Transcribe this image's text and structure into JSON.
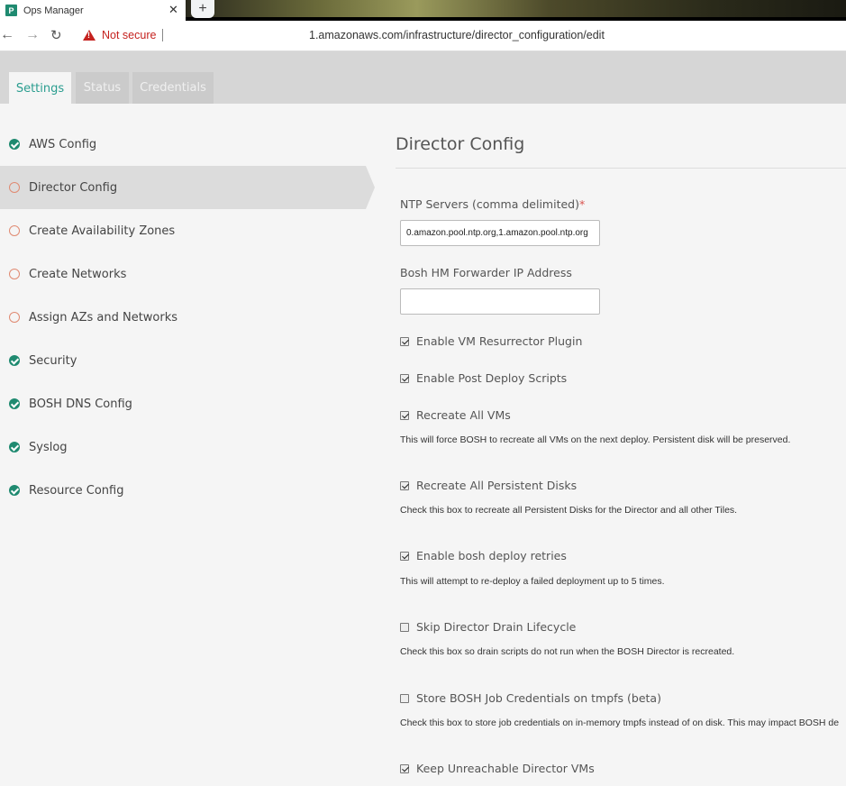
{
  "browser": {
    "tab_title": "Ops Manager",
    "favicon_letter": "P",
    "security_label": "Not secure",
    "url": "1.amazonaws.com/infrastructure/director_configuration/edit"
  },
  "app_tabs": [
    {
      "label": "Settings",
      "active": true
    },
    {
      "label": "Status",
      "active": false
    },
    {
      "label": "Credentials",
      "active": false
    }
  ],
  "sidebar": {
    "items": [
      {
        "label": "AWS Config",
        "status": "complete"
      },
      {
        "label": "Director Config",
        "status": "incomplete",
        "active": true
      },
      {
        "label": "Create Availability Zones",
        "status": "incomplete"
      },
      {
        "label": "Create Networks",
        "status": "incomplete"
      },
      {
        "label": "Assign AZs and Networks",
        "status": "incomplete"
      },
      {
        "label": "Security",
        "status": "complete"
      },
      {
        "label": "BOSH DNS Config",
        "status": "complete"
      },
      {
        "label": "Syslog",
        "status": "complete"
      },
      {
        "label": "Resource Config",
        "status": "complete"
      }
    ]
  },
  "main": {
    "title": "Director Config",
    "ntp": {
      "label": "NTP Servers (comma delimited)",
      "required_mark": "*",
      "value": "0.amazon.pool.ntp.org,1.amazon.pool.ntp.org"
    },
    "bosh_hm": {
      "label": "Bosh HM Forwarder IP Address",
      "value": ""
    },
    "options": [
      {
        "label": "Enable VM Resurrector Plugin",
        "checked": true,
        "help": ""
      },
      {
        "label": "Enable Post Deploy Scripts",
        "checked": true,
        "help": ""
      },
      {
        "label": "Recreate All VMs",
        "checked": true,
        "help": "This will force BOSH to recreate all VMs on the next deploy. Persistent disk will be preserved."
      },
      {
        "label": "Recreate All Persistent Disks",
        "checked": true,
        "help": "Check this box to recreate all Persistent Disks for the Director and all other Tiles."
      },
      {
        "label": "Enable bosh deploy retries",
        "checked": true,
        "help": "This will attempt to re-deploy a failed deployment up to 5 times."
      },
      {
        "label": "Skip Director Drain Lifecycle",
        "checked": false,
        "help": "Check this box so drain scripts do not run when the BOSH Director is recreated."
      },
      {
        "label": "Store BOSH Job Credentials on tmpfs (beta)",
        "checked": false,
        "help": "Check this box to store job credentials on in-memory tmpfs instead of on disk. This may impact BOSH de"
      },
      {
        "label": "Keep Unreachable Director VMs",
        "checked": true,
        "help": ""
      }
    ]
  }
}
